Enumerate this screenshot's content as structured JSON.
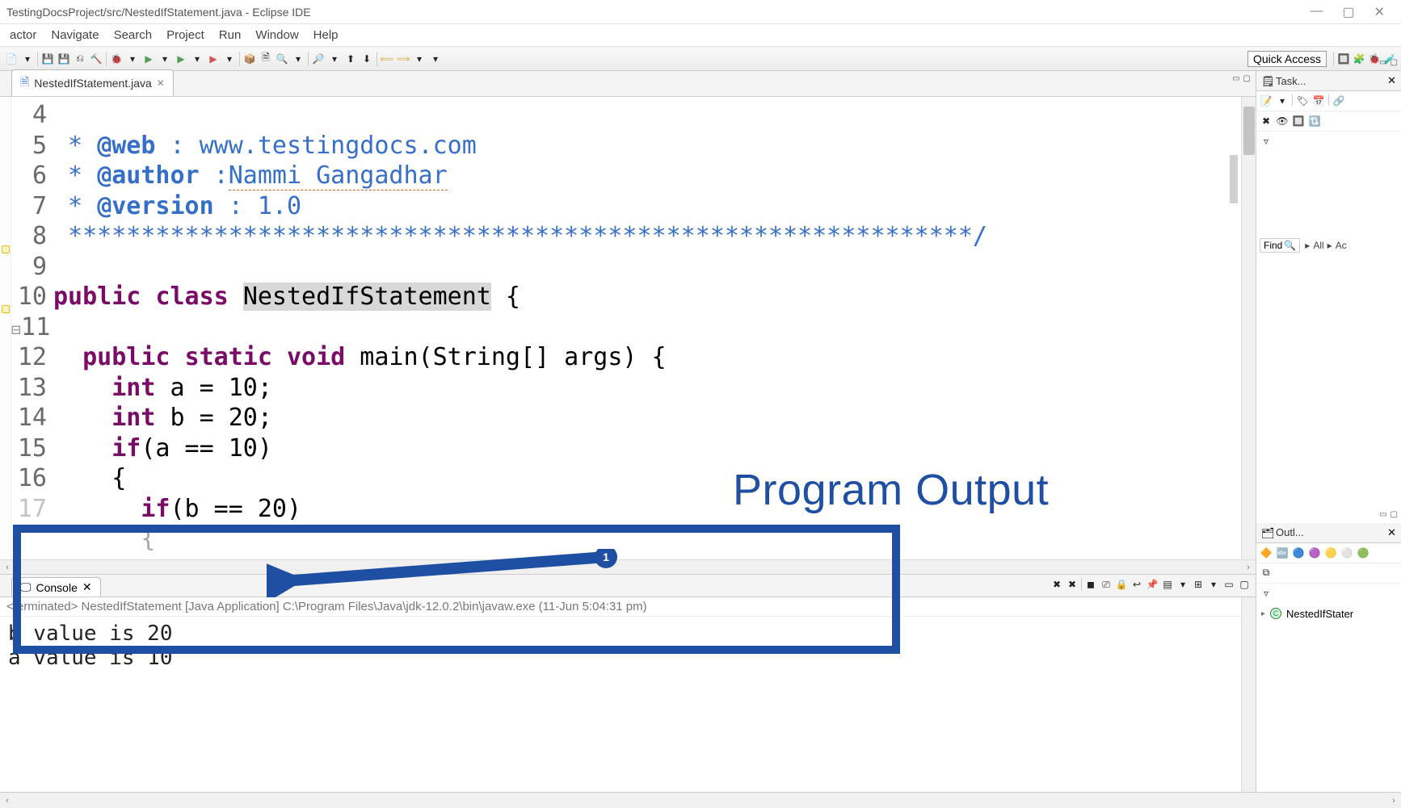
{
  "window": {
    "title": "TestingDocsProject/src/NestedIfStatement.java - Eclipse IDE"
  },
  "menu": [
    "actor",
    "Navigate",
    "Search",
    "Project",
    "Run",
    "Window",
    "Help"
  ],
  "quick_access": "Quick Access",
  "editor": {
    "tab_label": "NestedIfStatement.java",
    "lines": [
      4,
      5,
      6,
      7,
      8,
      9,
      10,
      11,
      12,
      13,
      14,
      15,
      16,
      17
    ],
    "code": {
      "l4_a": " * ",
      "l4_b": "@web",
      "l4_c": " : www.testingdocs.com",
      "l5_a": " * ",
      "l5_b": "@author",
      "l5_c": " :",
      "l5_d": "Nammi Gangadhar",
      "l6_a": " * ",
      "l6_b": "@version",
      "l6_c": " : 1.0",
      "l7": " **************************************************************/",
      "l8": "",
      "l9_pub": "public",
      "l9_cls": "class",
      "l9_name": "NestedIfStatement",
      "l9_brace": " {",
      "l10": "",
      "l11_pub": "public",
      "l11_stat": "static",
      "l11_void": "void",
      "l11_rest": " main(String[] args) {",
      "l12_kw": "int",
      "l12_rest": " a = 10;",
      "l13_kw": "int",
      "l13_rest": " b = 20;",
      "l14_kw": "if",
      "l14_rest": "(a == 10)",
      "l15": "    {",
      "l16_kw": "if",
      "l16_rest": "(b == 20)",
      "l17": "      {"
    }
  },
  "annotation": {
    "label": "Program Output",
    "callout_number": "1"
  },
  "console": {
    "tab_label": "Console",
    "terminated": "<terminated> NestedIfStatement [Java Application] C:\\Program Files\\Java\\jdk-12.0.2\\bin\\javaw.exe (11-Jun    5:04:31 pm)",
    "output": "b value is 20\na value is 10"
  },
  "tasks_view": {
    "title": "Task...",
    "find": "Find",
    "crumb_all": "All",
    "crumb_ac": "Ac"
  },
  "outline_view": {
    "title": "Outl...",
    "item": "NestedIfStater"
  }
}
